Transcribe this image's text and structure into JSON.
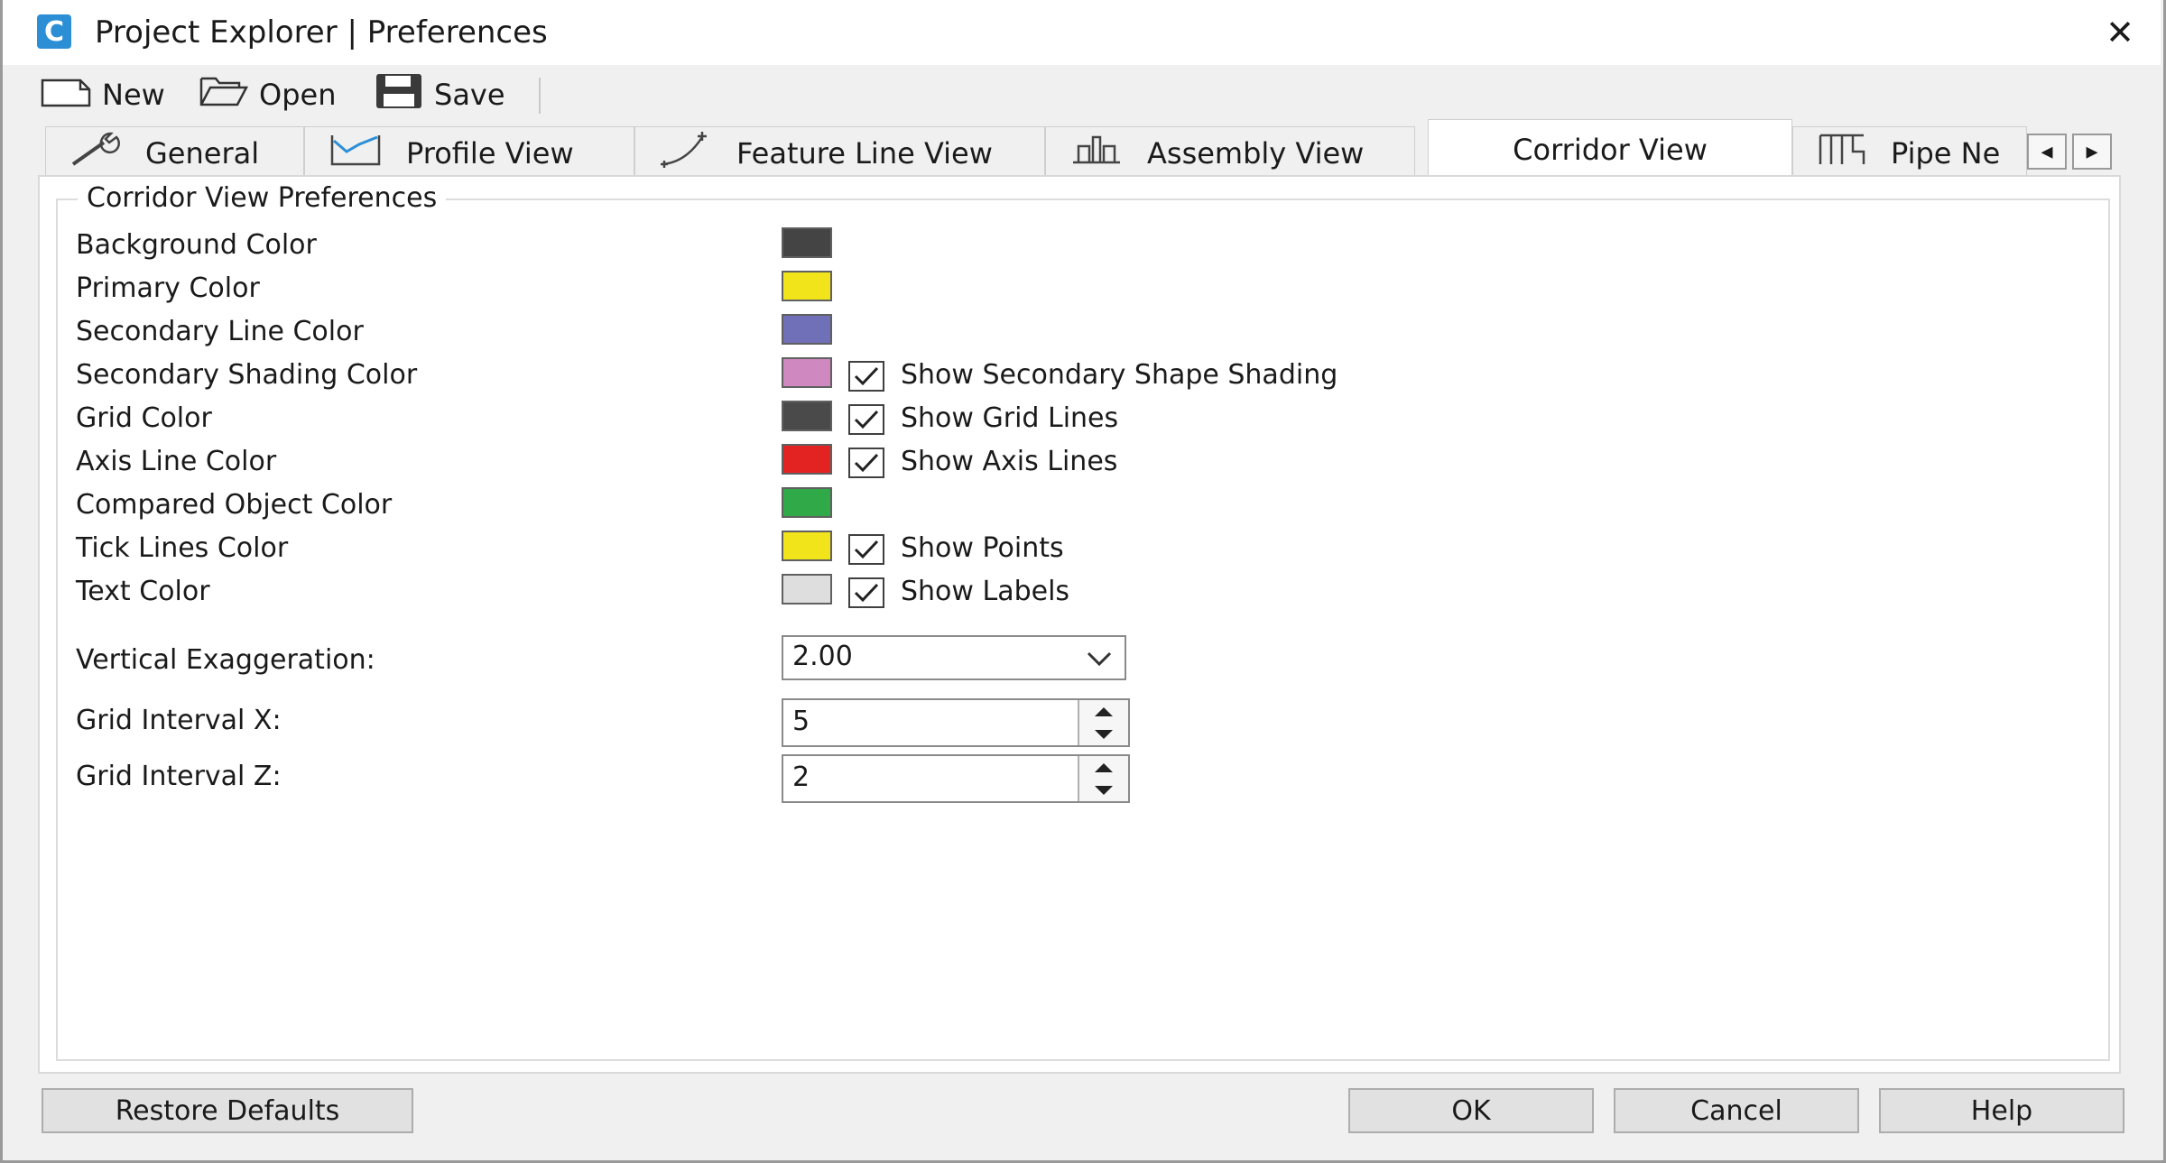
{
  "window": {
    "title": "Project Explorer | Preferences",
    "app_icon_letter": "C",
    "close_glyph": "✕"
  },
  "toolbar": {
    "new_label": "New",
    "open_label": "Open",
    "save_label": "Save"
  },
  "tabs": [
    {
      "label": "General",
      "icon": "wrench-icon",
      "active": false
    },
    {
      "label": "Profile View",
      "icon": "profile-view-icon",
      "active": false
    },
    {
      "label": "Feature Line View",
      "icon": "feature-line-icon",
      "active": false
    },
    {
      "label": "Assembly View",
      "icon": "assembly-icon",
      "active": false
    },
    {
      "label": "Corridor View",
      "icon": "",
      "active": true
    },
    {
      "label": "Pipe Ne",
      "icon": "pipe-network-icon",
      "active": false
    }
  ],
  "tab_scroll": {
    "left": "◂",
    "right": "▸"
  },
  "group": {
    "title": "Corridor View Preferences",
    "rows": [
      {
        "label": "Background Color",
        "color": "#444444",
        "checkbox": null
      },
      {
        "label": "Primary Color",
        "color": "#f2e41a",
        "checkbox": null
      },
      {
        "label": "Secondary Line Color",
        "color": "#7070b8",
        "checkbox": null
      },
      {
        "label": "Secondary Shading Color",
        "color": "#d088c0",
        "checkbox": {
          "label": "Show Secondary Shape Shading",
          "checked": true
        }
      },
      {
        "label": "Grid Color",
        "color": "#4a4a4a",
        "checkbox": {
          "label": "Show Grid Lines",
          "checked": true
        }
      },
      {
        "label": "Axis Line Color",
        "color": "#e32222",
        "checkbox": {
          "label": "Show Axis Lines",
          "checked": true
        }
      },
      {
        "label": "Compared Object Color",
        "color": "#30aa48",
        "checkbox": null
      },
      {
        "label": "Tick Lines Color",
        "color": "#f2e41a",
        "checkbox": {
          "label": "Show Points",
          "checked": true
        }
      },
      {
        "label": "Text Color",
        "color": "#dedede",
        "checkbox": {
          "label": "Show Labels",
          "checked": true
        }
      }
    ],
    "vertical_exaggeration": {
      "label": "Vertical Exaggeration:",
      "value": "2.00"
    },
    "grid_interval_x": {
      "label": "Grid Interval X:",
      "value": "5"
    },
    "grid_interval_z": {
      "label": "Grid Interval Z:",
      "value": "2"
    }
  },
  "footer": {
    "restore_label": "Restore Defaults",
    "ok_label": "OK",
    "cancel_label": "Cancel",
    "help_label": "Help"
  }
}
